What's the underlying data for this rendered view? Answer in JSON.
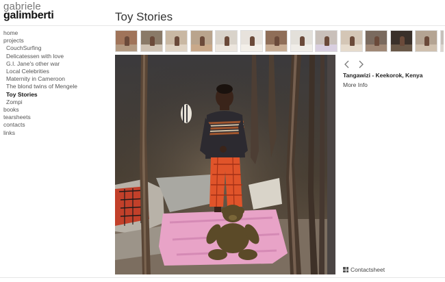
{
  "site": {
    "first_name": "gabriele",
    "last_name": "galimberti"
  },
  "page": {
    "title": "Toy Stories"
  },
  "nav": {
    "items": [
      {
        "label": "home",
        "level": 0,
        "active": false
      },
      {
        "label": "projects",
        "level": 0,
        "active": false
      },
      {
        "label": "CouchSurfing",
        "level": 1,
        "active": false
      },
      {
        "label": "Delicatessen with love",
        "level": 1,
        "active": false
      },
      {
        "label": "G.I. Jane's other war",
        "level": 1,
        "active": false
      },
      {
        "label": "Local Celebrities",
        "level": 1,
        "active": false
      },
      {
        "label": "Maternity in Cameroon",
        "level": 1,
        "active": false
      },
      {
        "label": "The blond twins of Mengele",
        "level": 1,
        "active": false
      },
      {
        "label": "Toy Stories",
        "level": 1,
        "active": true
      },
      {
        "label": "Zompi",
        "level": 1,
        "active": false
      },
      {
        "label": "books",
        "level": 0,
        "active": false
      },
      {
        "label": "tearsheets",
        "level": 0,
        "active": false
      },
      {
        "label": "contacts",
        "level": 0,
        "active": false
      },
      {
        "label": "links",
        "level": 0,
        "active": false
      }
    ]
  },
  "thumbnails": [
    {
      "bg": "#a0745a",
      "floor": "#b39a82"
    },
    {
      "bg": "#8a7a68",
      "floor": "#cfc2b3"
    },
    {
      "bg": "#c9b8a3",
      "floor": "#e0d4c4"
    },
    {
      "bg": "#b9a48d",
      "floor": "#c9a98a"
    },
    {
      "bg": "#d9d3ca",
      "floor": "#ece6de"
    },
    {
      "bg": "#e7e2dc",
      "floor": "#f3efe9"
    },
    {
      "bg": "#8f6e58",
      "floor": "#c8ad94"
    },
    {
      "bg": "#e3e0da",
      "floor": "#f0ede8"
    },
    {
      "bg": "#c9c0ba",
      "floor": "#d9cfe0"
    },
    {
      "bg": "#d4c6b6",
      "floor": "#e6dbcd"
    },
    {
      "bg": "#7a6a5e",
      "floor": "#a08876"
    },
    {
      "bg": "#3a302a",
      "floor": "#6a5848"
    },
    {
      "bg": "#b4a493",
      "floor": "#cfc0ae"
    },
    {
      "bg": "#c6c0ba",
      "floor": "#ddd7d0"
    }
  ],
  "photo": {
    "caption": "Tangawizi - Keekorok, Kenya"
  },
  "controls": {
    "prev_icon": "chevron-left-icon",
    "next_icon": "chevron-right-icon",
    "more_info": "More Info",
    "contactsheet_icon": "grid-icon",
    "contactsheet": "Contactsheet"
  }
}
